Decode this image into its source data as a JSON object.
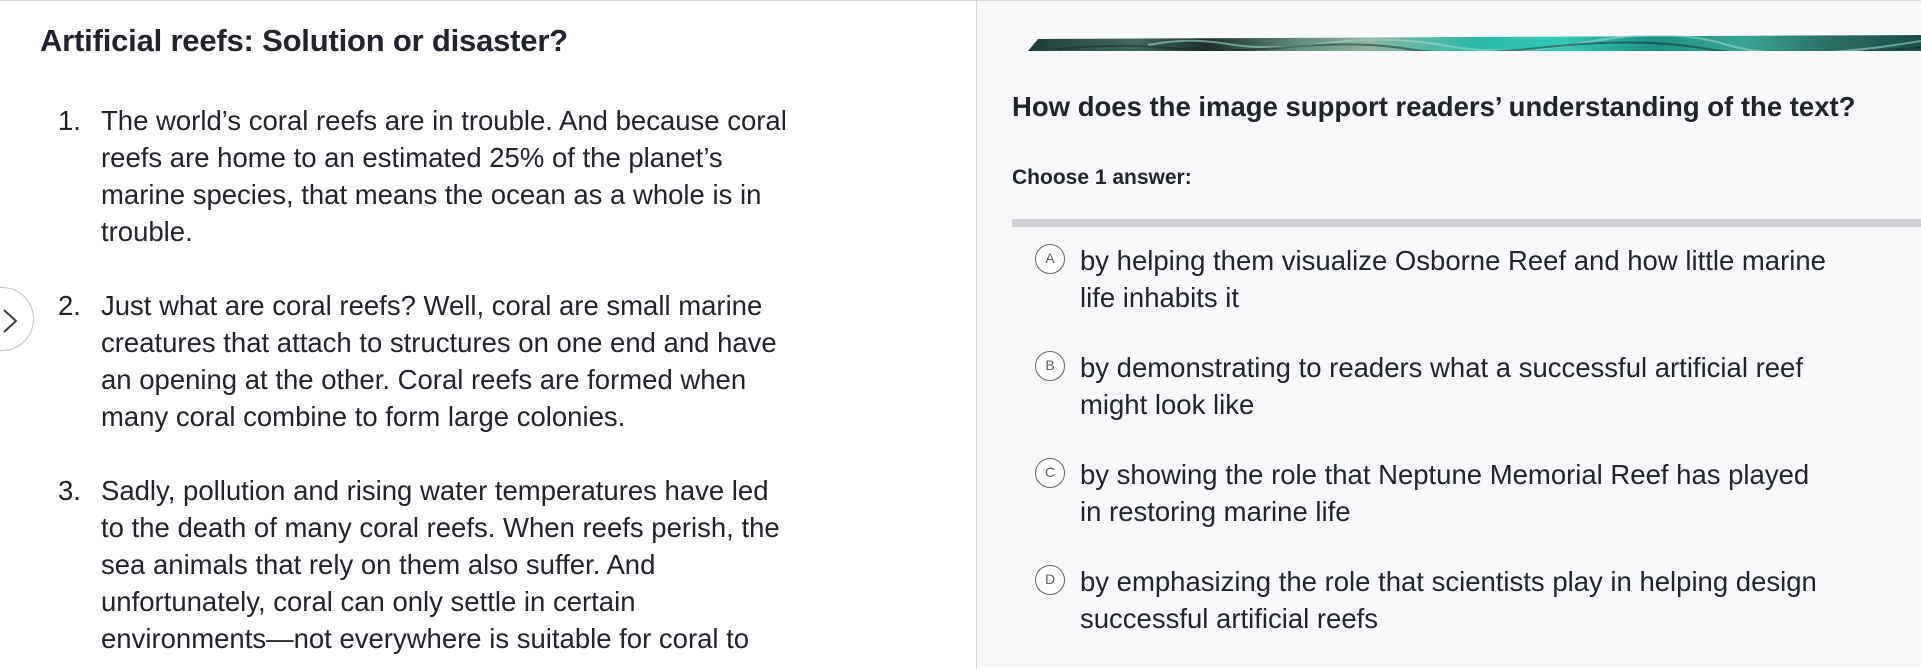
{
  "passage": {
    "title": "Artificial reefs: Solution or disaster?",
    "paragraphs": [
      {
        "number": "1.",
        "lines": [
          "The world’s coral reefs are in trouble. And because coral",
          "reefs are home to an estimated 25% of the planet’s",
          "marine species, that means the ocean as a whole is in",
          "trouble."
        ]
      },
      {
        "number": "2.",
        "lines": [
          "Just what are coral reefs? Well, coral are small marine",
          "creatures that attach to structures on one end and have",
          "an opening at the other. Coral reefs are formed when",
          "many coral combine to form large colonies."
        ]
      },
      {
        "number": "3.",
        "lines": [
          "Sadly, pollution and rising water temperatures have led",
          "to the death of many coral reefs. When reefs perish, the",
          "sea animals that rely on them also suffer. And",
          "unfortunately, coral can only settle in certain",
          "environments—not everywhere is suitable for coral to"
        ]
      }
    ],
    "expand_icon": "chevron-right-icon"
  },
  "question": {
    "prompt": "How does the image support readers’ understanding of the text?",
    "choose_label": "Choose 1 answer:",
    "image_icon": "reef-photo",
    "choices": [
      {
        "letter": "A",
        "lines": [
          "by helping them visualize Osborne Reef and how little marine",
          "life inhabits it"
        ]
      },
      {
        "letter": "B",
        "lines": [
          "by demonstrating to readers what a successful artificial reef",
          "might look like"
        ]
      },
      {
        "letter": "C",
        "lines": [
          "by showing the role that Neptune Memorial Reef has played",
          "in restoring marine life"
        ]
      },
      {
        "letter": "D",
        "lines": [
          "by emphasizing the role that scientists play in helping design",
          "successful artificial reefs"
        ]
      }
    ]
  },
  "colors": {
    "text": "#21242c",
    "pane_right_bg": "#f7f8fa",
    "divider": "#d6d8da",
    "bubble_border": "#5f6368",
    "reef_teal": "#2bb8a8"
  }
}
